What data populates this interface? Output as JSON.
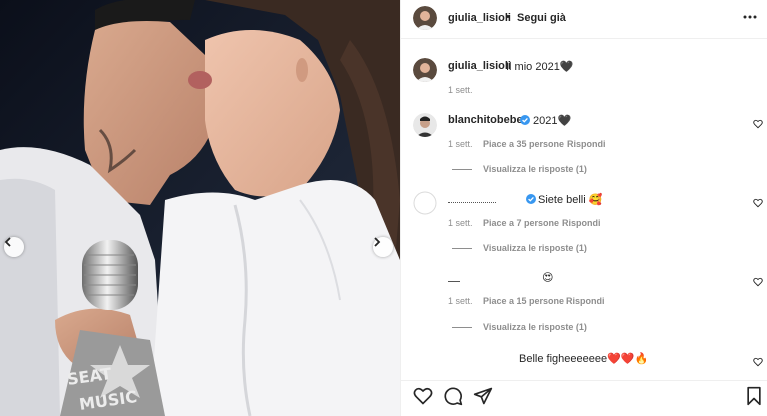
{
  "post": {
    "username": "giulia_lisioli",
    "dot": "•",
    "follow_label": "Segui già",
    "caption": {
      "username": "giulia_lisioli",
      "text": "Il mio 2021🖤",
      "time": "1 sett."
    }
  },
  "comments": [
    {
      "username": "blanchitobebe",
      "verified": true,
      "text": "2021🖤",
      "time": "1 sett.",
      "likes": "Piace a 35 persone",
      "reply": "Rispondi",
      "view_replies": "Visualizza le risposte (1)"
    },
    {
      "username": "",
      "verified": true,
      "text": "Siete belli 🥰",
      "time": "1 sett.",
      "likes": "Piace a 7 persone",
      "reply": "Rispondi",
      "view_replies": "Visualizza le risposte (1)"
    },
    {
      "username": "",
      "verified": false,
      "text": "😍",
      "time": "1 sett.",
      "likes": "Piace a 15 persone",
      "reply": "Rispondi",
      "view_replies": "Visualizza le risposte (1)"
    },
    {
      "username": "",
      "verified": false,
      "text": "Belle figheeeeeee❤️❤️🔥"
    }
  ],
  "photo": {
    "overlay_text_1": "SEAT",
    "overlay_text_2": "MUSIC"
  },
  "icons": {
    "more": "more-horizontal-icon",
    "like": "heart-outline-icon",
    "comment": "comment-bubble-icon",
    "share": "paper-plane-icon",
    "save": "bookmark-icon",
    "prev": "chevron-left-icon",
    "next": "chevron-right-icon",
    "verified": "verified-badge-icon"
  },
  "colors": {
    "verified": "#3897f0",
    "muted": "#8e8e8e",
    "text": "#262626",
    "divider": "#efefef"
  }
}
